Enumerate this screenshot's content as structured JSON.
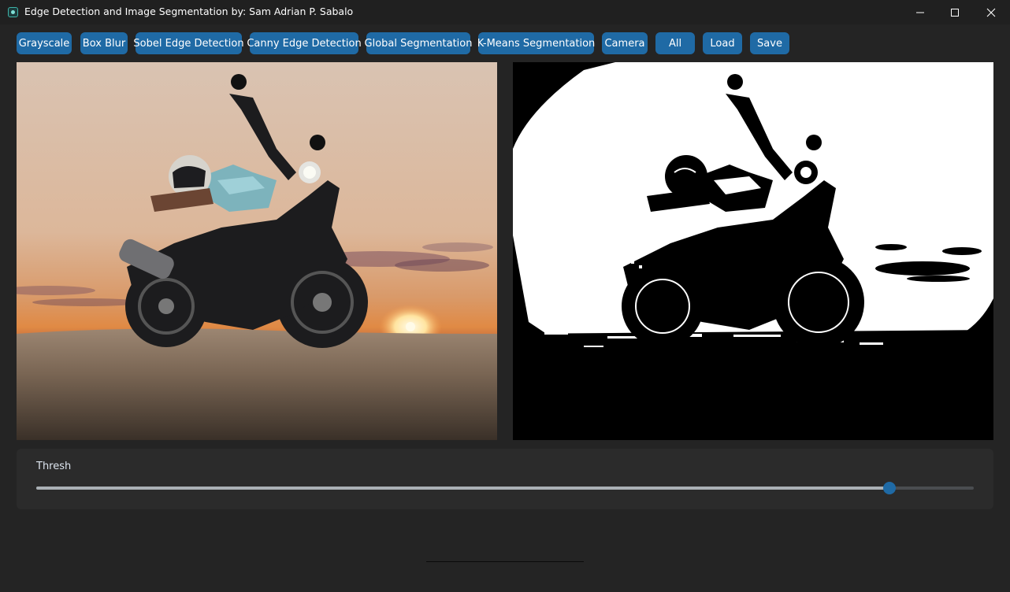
{
  "window": {
    "title": "Edge Detection and Image Segmentation by: Sam Adrian P. Sabalo",
    "icon": "app-icon",
    "controls": [
      "minimize-icon",
      "maximize-icon",
      "close-icon"
    ]
  },
  "toolbar": {
    "buttons": [
      {
        "label": "Grayscale"
      },
      {
        "label": "Box Blur"
      },
      {
        "label": "Sobel Edge Detection"
      },
      {
        "label": "Canny Edge Detection"
      },
      {
        "label": "Global Segmentation"
      },
      {
        "label": "K-Means Segmentation"
      },
      {
        "label": "Camera"
      },
      {
        "label": "All"
      },
      {
        "label": "Load"
      },
      {
        "label": "Save"
      }
    ]
  },
  "images": {
    "original": "motorcycle-photo",
    "processed": "segmented-motorcycle-photo"
  },
  "slider": {
    "label": "Thresh",
    "value_fraction": 0.91
  },
  "colors": {
    "accent": "#1f6aa5",
    "background": "#242424",
    "titlebar": "#202020",
    "frame": "#2b2b2b"
  }
}
